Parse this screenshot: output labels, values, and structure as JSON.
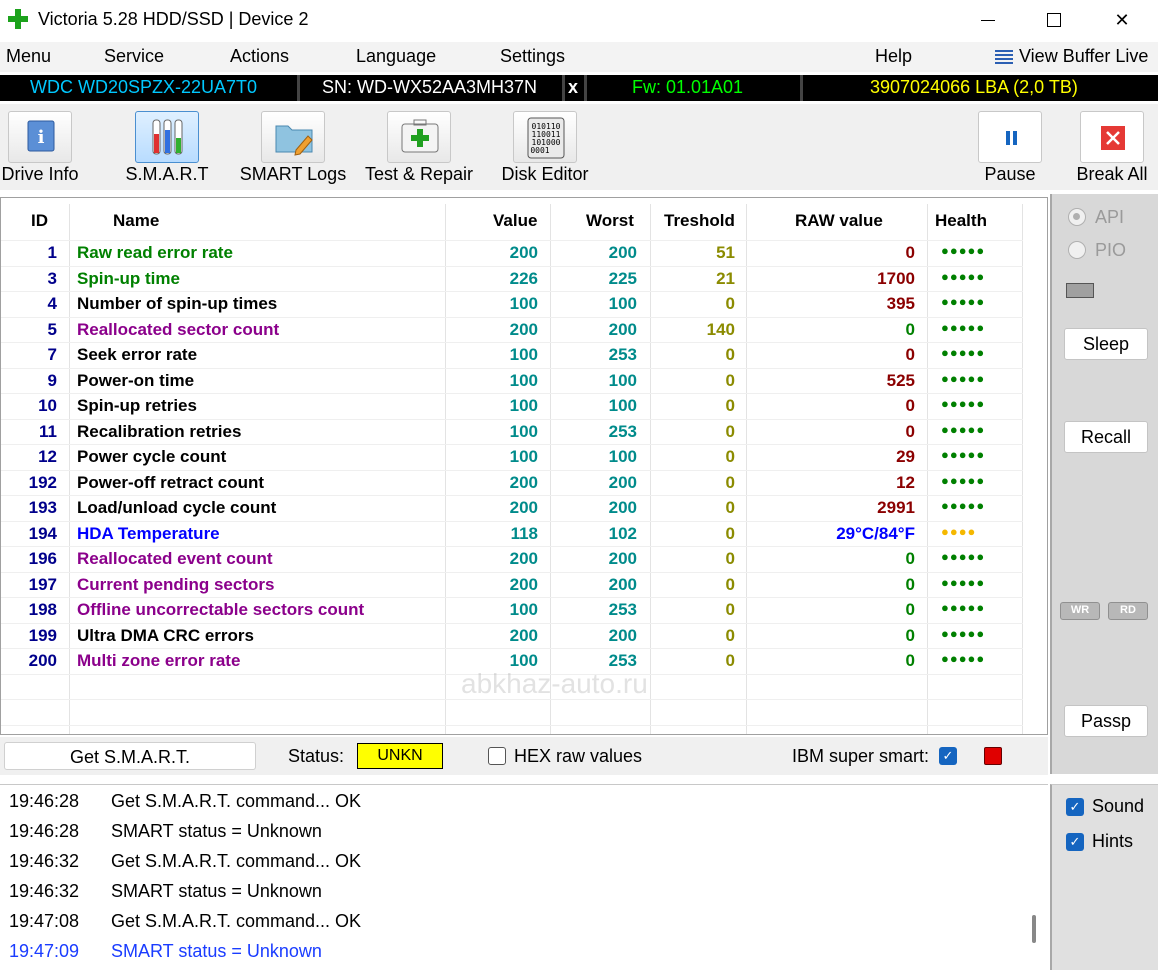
{
  "window": {
    "title": "Victoria 5.28 HDD/SSD | Device 2",
    "close_glyph": "✕"
  },
  "menu": {
    "items": [
      "Menu",
      "Service",
      "Actions",
      "Language",
      "Settings",
      "Help"
    ],
    "view_buffer": "View Buffer Live"
  },
  "device": {
    "model": "WDC WD20SPZX-22UA7T0",
    "serial": "SN: WD-WX52AA3MH37N",
    "close": "x",
    "firmware": "Fw: 01.01A01",
    "capacity": "3907024066 LBA (2,0 TB)",
    "colors": {
      "model": "#00c8ff",
      "serial": "#ffffff",
      "firmware": "#00ff00",
      "capacity": "#ffff00"
    }
  },
  "toolbar": {
    "drive_info": "Drive Info",
    "smart": "S.M.A.R.T",
    "smart_logs": "SMART Logs",
    "test_repair": "Test & Repair",
    "disk_editor": "Disk Editor",
    "pause": "Pause",
    "break_all": "Break All",
    "disk_editor_bits": "010110\n110011\n101000\n0001"
  },
  "table": {
    "headers": {
      "id": "ID",
      "name": "Name",
      "value": "Value",
      "worst": "Worst",
      "threshold": "Treshold",
      "raw": "RAW value",
      "health": "Health"
    },
    "rows": [
      {
        "id": "1",
        "name": "Raw read error rate",
        "value": "200",
        "worst": "200",
        "threshold": "51",
        "raw": "0",
        "health": "●●●●●",
        "name_color": "#008000",
        "raw_color": "#8b0000",
        "health_color": "#008000"
      },
      {
        "id": "3",
        "name": "Spin-up time",
        "value": "226",
        "worst": "225",
        "threshold": "21",
        "raw": "1700",
        "health": "●●●●●",
        "name_color": "#008000",
        "raw_color": "#8b0000",
        "health_color": "#008000"
      },
      {
        "id": "4",
        "name": "Number of spin-up times",
        "value": "100",
        "worst": "100",
        "threshold": "0",
        "raw": "395",
        "health": "●●●●●",
        "name_color": "#000000",
        "raw_color": "#8b0000",
        "health_color": "#008000"
      },
      {
        "id": "5",
        "name": "Reallocated sector count",
        "value": "200",
        "worst": "200",
        "threshold": "140",
        "raw": "0",
        "health": "●●●●●",
        "name_color": "#8b008b",
        "raw_color": "#008000",
        "health_color": "#008000"
      },
      {
        "id": "7",
        "name": "Seek error rate",
        "value": "100",
        "worst": "253",
        "threshold": "0",
        "raw": "0",
        "health": "●●●●●",
        "name_color": "#000000",
        "raw_color": "#8b0000",
        "health_color": "#008000"
      },
      {
        "id": "9",
        "name": "Power-on time",
        "value": "100",
        "worst": "100",
        "threshold": "0",
        "raw": "525",
        "health": "●●●●●",
        "name_color": "#000000",
        "raw_color": "#8b0000",
        "health_color": "#008000"
      },
      {
        "id": "10",
        "name": "Spin-up retries",
        "value": "100",
        "worst": "100",
        "threshold": "0",
        "raw": "0",
        "health": "●●●●●",
        "name_color": "#000000",
        "raw_color": "#8b0000",
        "health_color": "#008000"
      },
      {
        "id": "11",
        "name": "Recalibration retries",
        "value": "100",
        "worst": "253",
        "threshold": "0",
        "raw": "0",
        "health": "●●●●●",
        "name_color": "#000000",
        "raw_color": "#8b0000",
        "health_color": "#008000"
      },
      {
        "id": "12",
        "name": "Power cycle count",
        "value": "100",
        "worst": "100",
        "threshold": "0",
        "raw": "29",
        "health": "●●●●●",
        "name_color": "#000000",
        "raw_color": "#8b0000",
        "health_color": "#008000"
      },
      {
        "id": "192",
        "name": "Power-off retract count",
        "value": "200",
        "worst": "200",
        "threshold": "0",
        "raw": "12",
        "health": "●●●●●",
        "name_color": "#000000",
        "raw_color": "#8b0000",
        "health_color": "#008000"
      },
      {
        "id": "193",
        "name": "Load/unload cycle count",
        "value": "200",
        "worst": "200",
        "threshold": "0",
        "raw": "2991",
        "health": "●●●●●",
        "name_color": "#000000",
        "raw_color": "#8b0000",
        "health_color": "#008000"
      },
      {
        "id": "194",
        "name": "HDA Temperature",
        "value": "118",
        "worst": "102",
        "threshold": "0",
        "raw": "29°C/84°F",
        "health": "●●●●",
        "name_color": "#0000ff",
        "raw_color": "#0000ff",
        "health_color": "#f5b800"
      },
      {
        "id": "196",
        "name": "Reallocated event count",
        "value": "200",
        "worst": "200",
        "threshold": "0",
        "raw": "0",
        "health": "●●●●●",
        "name_color": "#8b008b",
        "raw_color": "#008000",
        "health_color": "#008000"
      },
      {
        "id": "197",
        "name": "Current pending sectors",
        "value": "200",
        "worst": "200",
        "threshold": "0",
        "raw": "0",
        "health": "●●●●●",
        "name_color": "#8b008b",
        "raw_color": "#008000",
        "health_color": "#008000"
      },
      {
        "id": "198",
        "name": "Offline uncorrectable sectors count",
        "value": "100",
        "worst": "253",
        "threshold": "0",
        "raw": "0",
        "health": "●●●●●",
        "name_color": "#8b008b",
        "raw_color": "#008000",
        "health_color": "#008000"
      },
      {
        "id": "199",
        "name": "Ultra DMA CRC errors",
        "value": "200",
        "worst": "200",
        "threshold": "0",
        "raw": "0",
        "health": "●●●●●",
        "name_color": "#000000",
        "raw_color": "#008000",
        "health_color": "#008000"
      },
      {
        "id": "200",
        "name": "Multi zone error rate",
        "value": "100",
        "worst": "253",
        "threshold": "0",
        "raw": "0",
        "health": "●●●●●",
        "name_color": "#8b008b",
        "raw_color": "#008000",
        "health_color": "#008000"
      }
    ]
  },
  "watermark": "abkhaz-auto.ru",
  "controls": {
    "get_smart": "Get S.M.A.R.T.",
    "status_label": "Status:",
    "status_value": "UNKN",
    "hex_label": "HEX raw values",
    "ibm_label": "IBM super smart:",
    "check_glyph": "✓"
  },
  "side": {
    "api": "API",
    "pio": "PIO",
    "sleep": "Sleep",
    "recall": "Recall",
    "wr": "WR",
    "rd": "RD",
    "passp": "Passp",
    "sound": "Sound",
    "hints": "Hints"
  },
  "log": [
    {
      "time": "19:46:28",
      "msg": "Get S.M.A.R.T. command... OK",
      "color": "#000000"
    },
    {
      "time": "19:46:28",
      "msg": "SMART status = Unknown",
      "color": "#000000"
    },
    {
      "time": "19:46:32",
      "msg": "Get S.M.A.R.T. command... OK",
      "color": "#000000"
    },
    {
      "time": "19:46:32",
      "msg": "SMART status = Unknown",
      "color": "#000000"
    },
    {
      "time": "19:47:08",
      "msg": "Get S.M.A.R.T. command... OK",
      "color": "#000000"
    },
    {
      "time": "19:47:09",
      "msg": "SMART status = Unknown",
      "color": "#1a3cff"
    }
  ]
}
